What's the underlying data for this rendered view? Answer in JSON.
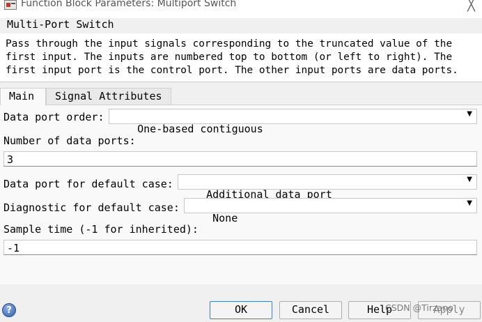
{
  "window": {
    "title": "Function Block Parameters: Multiport Switch",
    "close_glyph": "╳",
    "app_icon": "simulink-block-icon"
  },
  "block": {
    "name": "Multi-Port Switch",
    "description_lines": [
      "Pass through the input signals corresponding to the truncated value of the",
      "first input. The inputs are numbered top to bottom (or left to right). The",
      "first input port is the control port. The other input ports are data ports."
    ]
  },
  "tabs": [
    {
      "label": "Main",
      "active": true
    },
    {
      "label": "Signal Attributes",
      "active": false
    }
  ],
  "params": {
    "data_port_order": {
      "label": "Data port order:",
      "value": "One-based contiguous"
    },
    "num_ports": {
      "label": "Number of data ports:",
      "value": "3"
    },
    "default_case_port": {
      "label": "Data port for default case:",
      "value": "Additional data port"
    },
    "diagnostic": {
      "label": "Diagnostic for default case:",
      "value": "None"
    },
    "sample_time": {
      "label": "Sample time (-1 for inherited):",
      "value": "-1"
    }
  },
  "buttons": {
    "ok": "OK",
    "cancel": "Cancel",
    "help": "Help",
    "apply": "Apply"
  },
  "help_icon_glyph": "?",
  "watermark": "CSDN @Tirzano",
  "chevron_glyph": "▼"
}
